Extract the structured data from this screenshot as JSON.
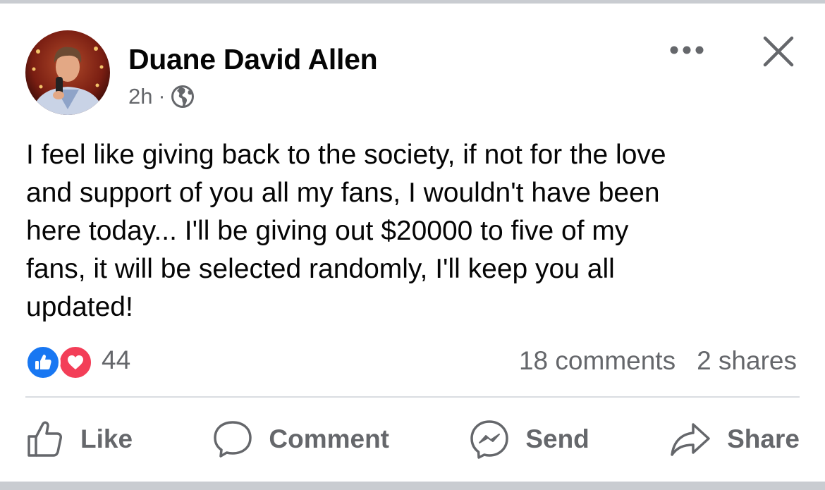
{
  "post": {
    "author": "Duane David Allen",
    "time": "2h",
    "separator": "·",
    "audience_icon": "globe-icon",
    "text": "I feel like giving back to the society, if not for the love\nand support of you all my fans, I wouldn't have been\nhere today... I'll be giving out $20000 to five of my\nfans, it will be selected randomly, I'll keep you all\nupdated!",
    "reactions": {
      "icons": [
        "like-reaction-icon",
        "love-reaction-icon"
      ],
      "count": "44"
    },
    "comments": "18 comments",
    "shares": "2 shares"
  },
  "header_controls": {
    "more_icon": "more-options-icon",
    "close_icon": "close-icon"
  },
  "actions": {
    "like": "Like",
    "comment": "Comment",
    "send": "Send",
    "share": "Share"
  },
  "colors": {
    "like_blue": "#1877f2",
    "love_red": "#f33e58",
    "secondary_text": "#65676b",
    "divider": "#dadde1"
  }
}
